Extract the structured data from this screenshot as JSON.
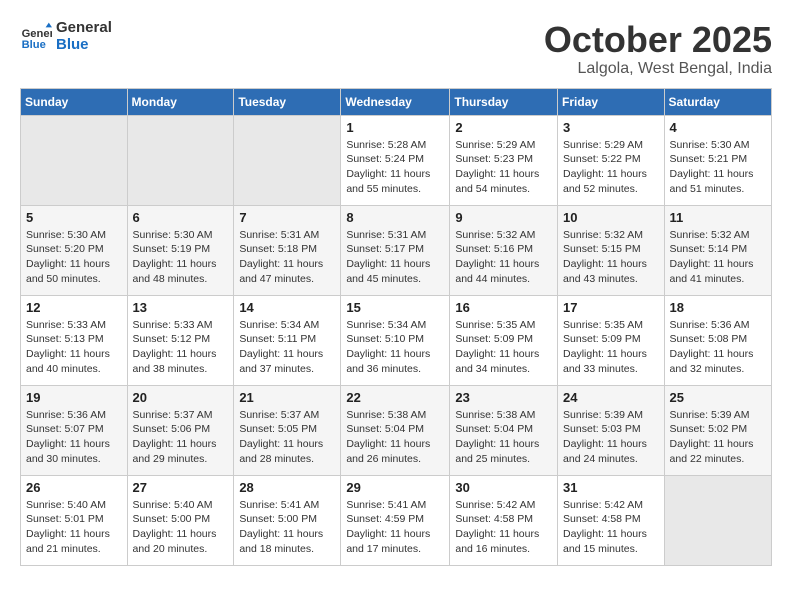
{
  "header": {
    "logo_line1": "General",
    "logo_line2": "Blue",
    "month": "October 2025",
    "location": "Lalgola, West Bengal, India"
  },
  "days_of_week": [
    "Sunday",
    "Monday",
    "Tuesday",
    "Wednesday",
    "Thursday",
    "Friday",
    "Saturday"
  ],
  "weeks": [
    [
      {
        "day": "",
        "info": ""
      },
      {
        "day": "",
        "info": ""
      },
      {
        "day": "",
        "info": ""
      },
      {
        "day": "1",
        "info": "Sunrise: 5:28 AM\nSunset: 5:24 PM\nDaylight: 11 hours and 55 minutes."
      },
      {
        "day": "2",
        "info": "Sunrise: 5:29 AM\nSunset: 5:23 PM\nDaylight: 11 hours and 54 minutes."
      },
      {
        "day": "3",
        "info": "Sunrise: 5:29 AM\nSunset: 5:22 PM\nDaylight: 11 hours and 52 minutes."
      },
      {
        "day": "4",
        "info": "Sunrise: 5:30 AM\nSunset: 5:21 PM\nDaylight: 11 hours and 51 minutes."
      }
    ],
    [
      {
        "day": "5",
        "info": "Sunrise: 5:30 AM\nSunset: 5:20 PM\nDaylight: 11 hours and 50 minutes."
      },
      {
        "day": "6",
        "info": "Sunrise: 5:30 AM\nSunset: 5:19 PM\nDaylight: 11 hours and 48 minutes."
      },
      {
        "day": "7",
        "info": "Sunrise: 5:31 AM\nSunset: 5:18 PM\nDaylight: 11 hours and 47 minutes."
      },
      {
        "day": "8",
        "info": "Sunrise: 5:31 AM\nSunset: 5:17 PM\nDaylight: 11 hours and 45 minutes."
      },
      {
        "day": "9",
        "info": "Sunrise: 5:32 AM\nSunset: 5:16 PM\nDaylight: 11 hours and 44 minutes."
      },
      {
        "day": "10",
        "info": "Sunrise: 5:32 AM\nSunset: 5:15 PM\nDaylight: 11 hours and 43 minutes."
      },
      {
        "day": "11",
        "info": "Sunrise: 5:32 AM\nSunset: 5:14 PM\nDaylight: 11 hours and 41 minutes."
      }
    ],
    [
      {
        "day": "12",
        "info": "Sunrise: 5:33 AM\nSunset: 5:13 PM\nDaylight: 11 hours and 40 minutes."
      },
      {
        "day": "13",
        "info": "Sunrise: 5:33 AM\nSunset: 5:12 PM\nDaylight: 11 hours and 38 minutes."
      },
      {
        "day": "14",
        "info": "Sunrise: 5:34 AM\nSunset: 5:11 PM\nDaylight: 11 hours and 37 minutes."
      },
      {
        "day": "15",
        "info": "Sunrise: 5:34 AM\nSunset: 5:10 PM\nDaylight: 11 hours and 36 minutes."
      },
      {
        "day": "16",
        "info": "Sunrise: 5:35 AM\nSunset: 5:09 PM\nDaylight: 11 hours and 34 minutes."
      },
      {
        "day": "17",
        "info": "Sunrise: 5:35 AM\nSunset: 5:09 PM\nDaylight: 11 hours and 33 minutes."
      },
      {
        "day": "18",
        "info": "Sunrise: 5:36 AM\nSunset: 5:08 PM\nDaylight: 11 hours and 32 minutes."
      }
    ],
    [
      {
        "day": "19",
        "info": "Sunrise: 5:36 AM\nSunset: 5:07 PM\nDaylight: 11 hours and 30 minutes."
      },
      {
        "day": "20",
        "info": "Sunrise: 5:37 AM\nSunset: 5:06 PM\nDaylight: 11 hours and 29 minutes."
      },
      {
        "day": "21",
        "info": "Sunrise: 5:37 AM\nSunset: 5:05 PM\nDaylight: 11 hours and 28 minutes."
      },
      {
        "day": "22",
        "info": "Sunrise: 5:38 AM\nSunset: 5:04 PM\nDaylight: 11 hours and 26 minutes."
      },
      {
        "day": "23",
        "info": "Sunrise: 5:38 AM\nSunset: 5:04 PM\nDaylight: 11 hours and 25 minutes."
      },
      {
        "day": "24",
        "info": "Sunrise: 5:39 AM\nSunset: 5:03 PM\nDaylight: 11 hours and 24 minutes."
      },
      {
        "day": "25",
        "info": "Sunrise: 5:39 AM\nSunset: 5:02 PM\nDaylight: 11 hours and 22 minutes."
      }
    ],
    [
      {
        "day": "26",
        "info": "Sunrise: 5:40 AM\nSunset: 5:01 PM\nDaylight: 11 hours and 21 minutes."
      },
      {
        "day": "27",
        "info": "Sunrise: 5:40 AM\nSunset: 5:00 PM\nDaylight: 11 hours and 20 minutes."
      },
      {
        "day": "28",
        "info": "Sunrise: 5:41 AM\nSunset: 5:00 PM\nDaylight: 11 hours and 18 minutes."
      },
      {
        "day": "29",
        "info": "Sunrise: 5:41 AM\nSunset: 4:59 PM\nDaylight: 11 hours and 17 minutes."
      },
      {
        "day": "30",
        "info": "Sunrise: 5:42 AM\nSunset: 4:58 PM\nDaylight: 11 hours and 16 minutes."
      },
      {
        "day": "31",
        "info": "Sunrise: 5:42 AM\nSunset: 4:58 PM\nDaylight: 11 hours and 15 minutes."
      },
      {
        "day": "",
        "info": ""
      }
    ]
  ]
}
